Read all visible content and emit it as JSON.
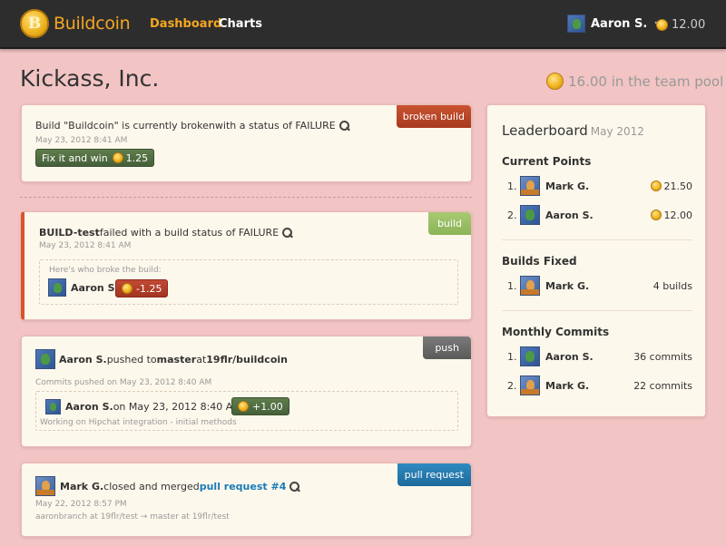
{
  "nav": {
    "brand": "Buildcoin",
    "brand_letter": "B",
    "links": [
      "Dashboard",
      "Charts"
    ],
    "user": "Aaron S.",
    "coins": "12.00"
  },
  "page": {
    "title": "Kickass, Inc.",
    "pool": "16.00 in the team pool"
  },
  "feed": {
    "broken": {
      "label": "broken build",
      "pre": "Build \"Buildcoin\" is currently broken",
      "mid": " with a status of FAILURE",
      "time": "May 23, 2012 8:41 AM",
      "button": "Fix it and win",
      "button_value": "1.25"
    },
    "build": {
      "label": "build",
      "name": "BUILD-test",
      "mid": " failed with a build status of FAILURE",
      "time": "May 23, 2012 8:41 AM",
      "breakers_heading": "Here's who broke the build:",
      "breaker": "Aaron S.",
      "penalty": "-1.25"
    },
    "push": {
      "label": "push",
      "user": "Aaron S.",
      "mid1": " pushed to ",
      "branch": "master",
      "mid2": " at ",
      "repo": "19flr/buildcoin",
      "subtitle": "Commits pushed on May 23, 2012 8:40 AM",
      "commit_user": "Aaron S.",
      "commit_time": " on May 23, 2012 8:40 AM",
      "reward": "+1.00",
      "message": "Working on Hipchat integration - initial methods"
    },
    "pr": {
      "label": "pull request",
      "user": "Mark G.",
      "mid": " closed and merged ",
      "link": "pull request #4",
      "time": "May 22, 2012 8:57 PM",
      "branches": "aaronbranch at 19flr/test → master at 19flr/test"
    }
  },
  "leaderboard": {
    "title": "Leaderboard",
    "period": "May 2012",
    "current_points": {
      "title": "Current Points",
      "rows": [
        {
          "rank": "1.",
          "name": "Mark G.",
          "value": "21.50"
        },
        {
          "rank": "2.",
          "name": "Aaron S.",
          "value": "12.00"
        }
      ]
    },
    "builds_fixed": {
      "title": "Builds Fixed",
      "rows": [
        {
          "rank": "1.",
          "name": "Mark G.",
          "value": "4 builds"
        }
      ]
    },
    "monthly_commits": {
      "title": "Monthly Commits",
      "rows": [
        {
          "rank": "1.",
          "name": "Aaron S.",
          "value": "36 commits"
        },
        {
          "rank": "2.",
          "name": "Mark G.",
          "value": "22 commits"
        }
      ]
    }
  },
  "colors": {
    "background": "#f2c4c4",
    "accent": "#f5a623",
    "card": "#fdf8ec",
    "broken": "#b8452a",
    "build": "#9bbf66",
    "push": "#666666",
    "pull_request": "#1e6a9c"
  }
}
